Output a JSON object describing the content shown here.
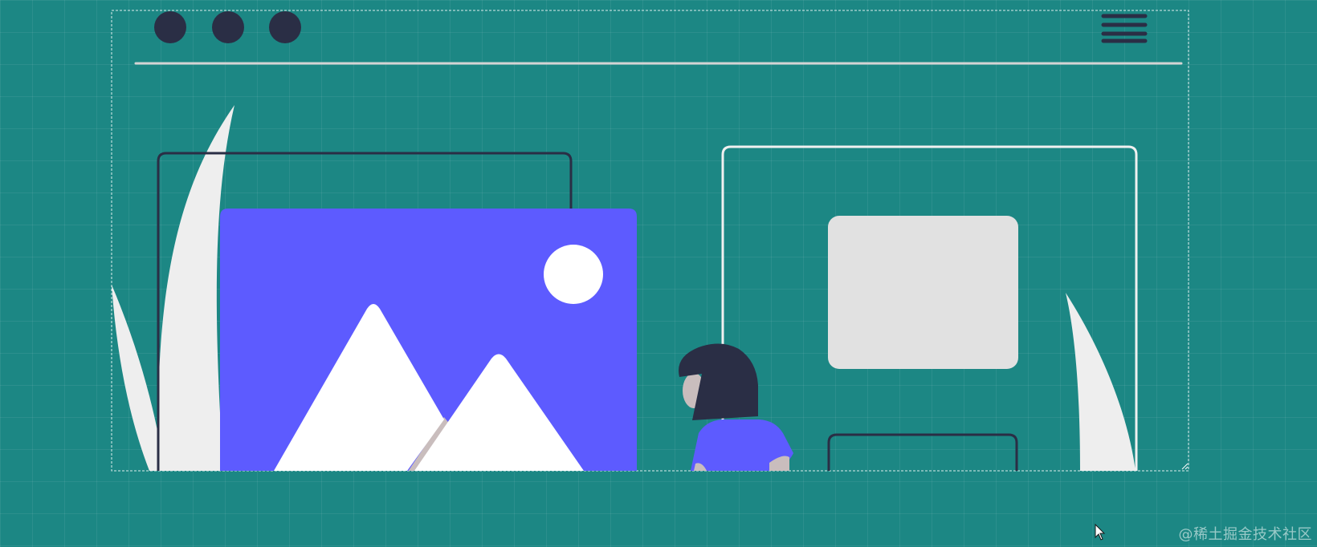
{
  "colors": {
    "background": "#1c8784",
    "dark": "#2a2e45",
    "accent": "#5d5bff",
    "light": "#eeeeee",
    "card_fill": "#e1e1e1",
    "skin": "#c9bdbd",
    "white": "#ffffff"
  },
  "browser": {
    "window_controls": [
      "control-dot",
      "control-dot",
      "control-dot"
    ],
    "menu_icon": "hamburger-menu-icon"
  },
  "illustration": {
    "left_card": "image-placeholder-icon",
    "right_card": "card-outline"
  },
  "watermark": "@稀土掘金技术社区"
}
